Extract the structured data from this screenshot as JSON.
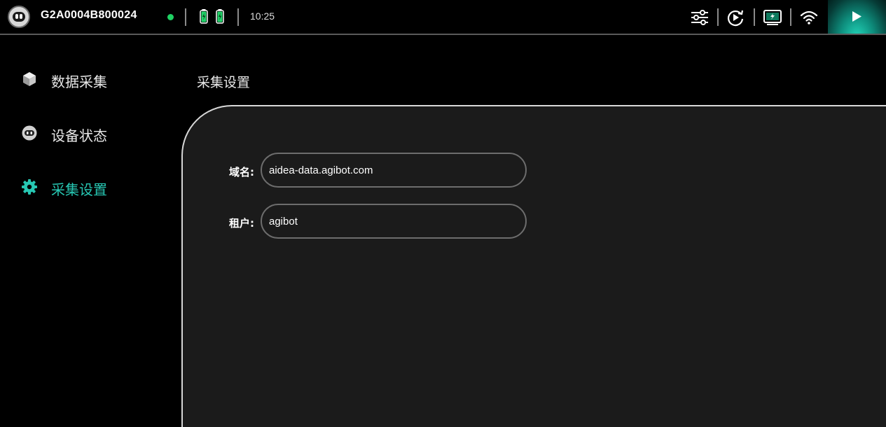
{
  "header": {
    "device_id": "G2A0004B800024",
    "time": "10:25",
    "status_color": "#1fd163",
    "accent_color": "#27c7b3",
    "icons": [
      "robot-avatar",
      "battery-charging-icon",
      "battery-charging-icon",
      "sliders-icon",
      "replay-icon",
      "screen-icon",
      "wifi-icon",
      "play-icon"
    ]
  },
  "sidebar": {
    "items": [
      {
        "label": "数据采集",
        "icon": "cube-icon",
        "active": false
      },
      {
        "label": "设备状态",
        "icon": "robot-head-icon",
        "active": false
      },
      {
        "label": "采集设置",
        "icon": "gear-icon",
        "active": true
      }
    ]
  },
  "main": {
    "title": "采集设置",
    "fields": [
      {
        "label": "域名:",
        "value": "aidea-data.agibot.com"
      },
      {
        "label": "租户:",
        "value": "agibot"
      }
    ]
  }
}
